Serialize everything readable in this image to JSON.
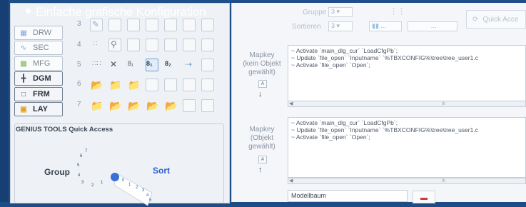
{
  "bullet": {
    "text": "Einfache grafische Konfiguration"
  },
  "modes": [
    {
      "label": "DRW",
      "active": false
    },
    {
      "label": "SEC",
      "active": false
    },
    {
      "label": "MFG",
      "active": false
    },
    {
      "label": "DGM",
      "active": true
    },
    {
      "label": "FRM",
      "active": true
    },
    {
      "label": "LAY",
      "active": true
    }
  ],
  "row_numbers": [
    "3",
    "4",
    "5",
    "6",
    "7"
  ],
  "quick_access": {
    "title": "GENIUS TOOLS Quick Access",
    "group_label": "Group",
    "sort_label": "Sort",
    "left_numbers": [
      "7",
      "6",
      "5",
      "4",
      "3",
      "2",
      "1"
    ],
    "right_numbers": [
      "0",
      "1",
      "2",
      "3",
      "4",
      "5"
    ]
  },
  "top_controls": {
    "gruppe_label": "Gruppe",
    "gruppe_value": "3",
    "sortieren_label": "Sortieren",
    "sortieren_value": "3",
    "btn_small": "...",
    "btn_dots": "...",
    "quick_access_label": "Quick Acce"
  },
  "mapkey1": {
    "label": "Mapkey\n(kein Objekt\ngewählt)",
    "small_btn": "A",
    "arrow": "↓",
    "lines": [
      "~ Activate `main_dlg_cur` `LoadCfgPb`;",
      "~ Update `file_open` `Inputname` `%TBXCONFIG%\\tree\\tree_user1.c",
      "~ Activate `file_open` `Open`;"
    ]
  },
  "mapkey2": {
    "label": "Mapkey\n(Objekt\ngewählt)",
    "small_btn": "A",
    "arrow": "↑",
    "lines": [
      "~ Activate `main_dlg_cur` `LoadCfgPb`;",
      "~ Update `file_open` `Inputname` `%TBXCONFIG%\\tree\\tree_user1.c",
      "~ Activate `file_open` `Open`;"
    ]
  },
  "scroll_grip": "III",
  "modellbaum": "Modellbaum",
  "colors": {
    "accent_blue": "#2d5fd0",
    "frame_blue": "#1f4f8a"
  }
}
